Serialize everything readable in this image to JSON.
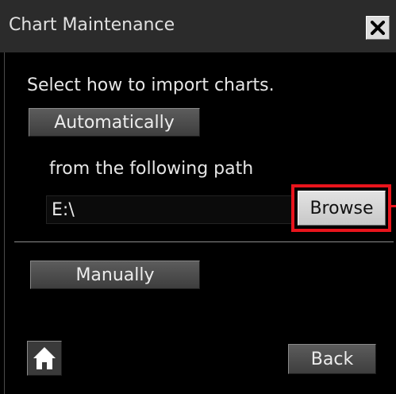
{
  "window": {
    "title": "Chart Maintenance",
    "close_icon": "close-icon"
  },
  "instruction": "Select how to import charts.",
  "automatic": {
    "button_label": "Automatically",
    "path_label": "from the following path",
    "path_value": "E:\\",
    "browse_label": "Browse"
  },
  "manual": {
    "button_label": "Manually"
  },
  "footer": {
    "home_icon": "home-icon",
    "back_label": "Back"
  },
  "colors": {
    "background": "#000000",
    "titlebar": "#2b2b2b",
    "highlight": "#e8141c"
  }
}
